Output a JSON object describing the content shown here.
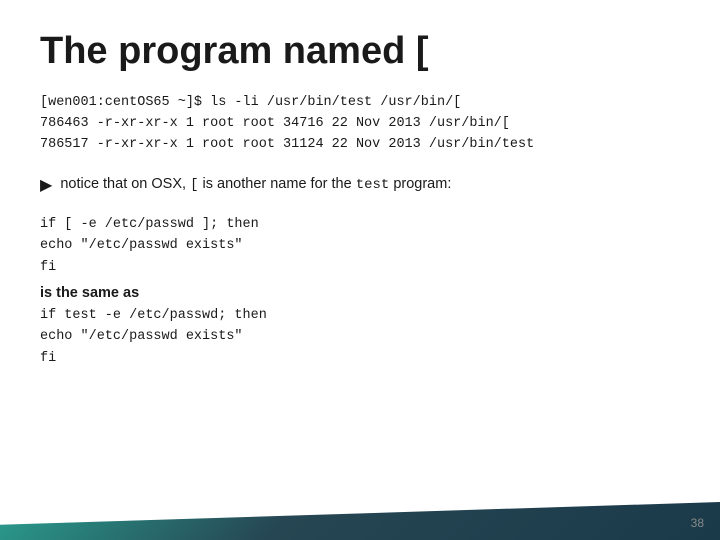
{
  "slide": {
    "title": "The program named [",
    "cmd_block": {
      "line1": "[wen001:centOS65 ~]$ ls -li /usr/bin/test /usr/bin/[",
      "line2": "786463 -r-xr-xr-x 1 root root  34716 22 Nov  2013 /usr/bin/[",
      "line3": "786517 -r-xr-xr-x 1 root root  31124 22 Nov  2013 /usr/bin/test"
    },
    "bullet": {
      "arrow": "▶",
      "text_before": "notice that on OSX,",
      "code": "[",
      "text_after": "is another name for the",
      "code2": "test",
      "text_end": "program:"
    },
    "code_block1": {
      "line1": "if [ -e /etc/passwd ]; then",
      "line2": "    echo \"/etc/passwd exists\"",
      "line3": "fi"
    },
    "middle_text": "is the same as",
    "code_block2": {
      "line1": "if test -e /etc/passwd; then",
      "line2": "    echo \"/etc/passwd exists\"",
      "line3": "fi"
    },
    "slide_number": "38"
  }
}
